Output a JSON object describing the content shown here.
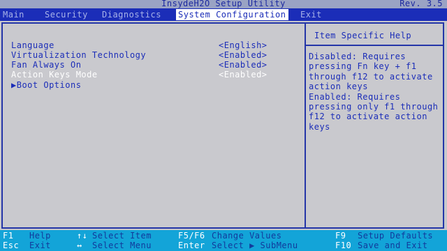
{
  "title": "InsydeH2O Setup Utility",
  "version": "Rev. 3.5",
  "menu": [
    {
      "label": "Main"
    },
    {
      "label": "Security"
    },
    {
      "label": "Diagnostics"
    },
    {
      "label": "System Configuration",
      "active": true
    },
    {
      "label": "Exit"
    }
  ],
  "settings": [
    {
      "label": "Language",
      "value": "<English>"
    },
    {
      "label": "Virtualization Technology",
      "value": "<Enabled>"
    },
    {
      "label": "Fan Always On",
      "value": "<Enabled>"
    },
    {
      "label": "Action Keys Mode",
      "value": "<Enabled>",
      "selected": true
    },
    {
      "label": "▶Boot Options",
      "value": ""
    }
  ],
  "help": {
    "title": "Item Specific Help",
    "body": "Disabled: Requires\npressing Fn key + f1\nthrough f12 to activate\naction keys\nEnabled: Requires\npressing only f1 through\nf12 to activate action\nkeys"
  },
  "footer": {
    "f1": {
      "key": "F1",
      "desc": "Help"
    },
    "esc": {
      "key": "Esc",
      "desc": "Exit"
    },
    "select_item": {
      "key": "↑↓",
      "desc": "Select Item"
    },
    "select_menu": {
      "key": "↔",
      "desc": "Select Menu"
    },
    "change_values": {
      "key": "F5/F6",
      "desc": "Change Values"
    },
    "enter": {
      "key": "Enter",
      "desc": "Select ▶ SubMenu"
    },
    "f9": {
      "key": "F9",
      "desc": "Setup Defaults"
    },
    "f10": {
      "key": "F10",
      "desc": "Save and Exit"
    }
  },
  "colors": {
    "menubar": "#1b2db8",
    "panel": "#c9c9ce",
    "text": "#1b2db8",
    "selected": "#ffffff",
    "footer": "#13a4d8"
  }
}
